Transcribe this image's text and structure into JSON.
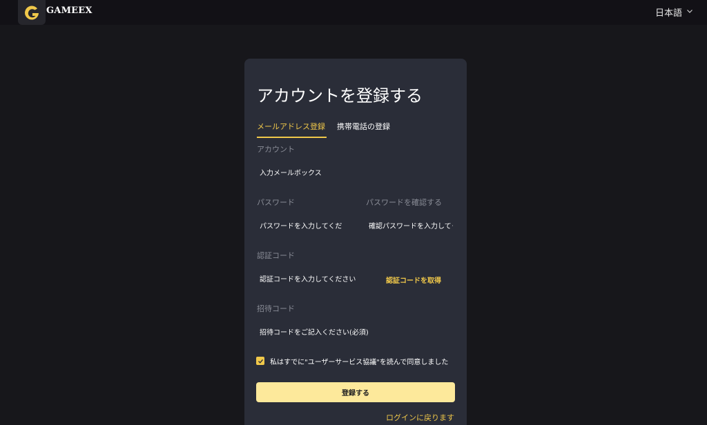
{
  "header": {
    "brand": "GAMEEX",
    "language": "日本語"
  },
  "register": {
    "title": "アカウントを登録する",
    "tabs": [
      {
        "label": "メールアドレス登録",
        "active": true
      },
      {
        "label": "携帯電話の登録",
        "active": false
      }
    ],
    "account": {
      "label": "アカウント",
      "placeholder": "入力メールボックス"
    },
    "password": {
      "label": "パスワード",
      "placeholder": "パスワードを入力してください"
    },
    "confirm_password": {
      "label": "パスワードを確認する",
      "placeholder": "確認パスワードを入力してください"
    },
    "verify_code": {
      "label": "認証コード",
      "placeholder": "認証コードを入力してください",
      "get_code": "認証コードを取得"
    },
    "invite_code": {
      "label": "招待コード",
      "placeholder": "招待コードをご記入ください(必須)"
    },
    "agreement": {
      "text": "私はすでに\"ユーザーサービス協議\"を読んで同意しました",
      "checked": true
    },
    "submit_label": "登録する",
    "back_to_login": "ログインに戻ります"
  },
  "colors": {
    "background": "#17171b",
    "card": "#2a2d38",
    "accent": "#f0c84a",
    "button": "#fde99b"
  }
}
